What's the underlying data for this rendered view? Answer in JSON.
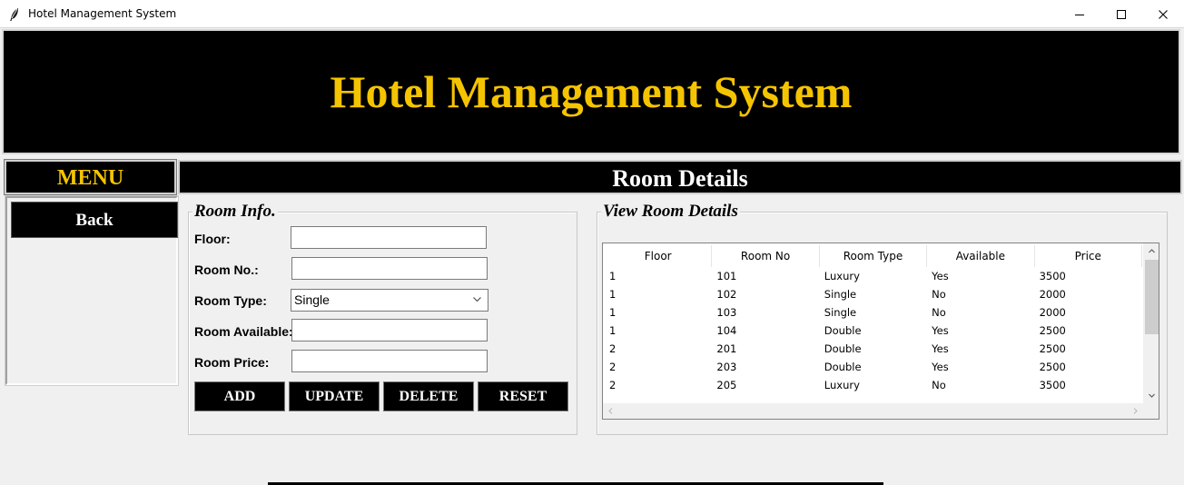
{
  "window": {
    "title": "Hotel Management System"
  },
  "banner": {
    "title": "Hotel Management System"
  },
  "menu": {
    "title": "MENU",
    "back_label": "Back"
  },
  "section": {
    "title": "Room Details"
  },
  "room_info": {
    "legend": "Room Info.",
    "floor_label": "Floor:",
    "floor_value": "",
    "room_no_label": "Room No.:",
    "room_no_value": "",
    "room_type_label": "Room Type:",
    "room_type_value": "Single",
    "room_available_label": "Room Available:",
    "room_available_value": "",
    "room_price_label": "Room Price:",
    "room_price_value": "",
    "buttons": {
      "add": "ADD",
      "update": "UPDATE",
      "delete": "DELETE",
      "reset": "RESET"
    }
  },
  "view_room": {
    "legend": "View Room Details",
    "columns": [
      "Floor",
      "Room No",
      "Room Type",
      "Available",
      "Price"
    ],
    "rows": [
      [
        "1",
        "101",
        "Luxury",
        "Yes",
        "3500"
      ],
      [
        "1",
        "102",
        "Single",
        "No",
        "2000"
      ],
      [
        "1",
        "103",
        "Single",
        "No",
        "2000"
      ],
      [
        "1",
        "104",
        "Double",
        "Yes",
        "2500"
      ],
      [
        "2",
        "201",
        "Double",
        "Yes",
        "2500"
      ],
      [
        "2",
        "203",
        "Double",
        "Yes",
        "2500"
      ],
      [
        "2",
        "205",
        "Luxury",
        "No",
        "3500"
      ]
    ]
  },
  "colors": {
    "banner_bg": "#000000",
    "title_gold": "#f5c400",
    "panel_bg": "#f0f0f0"
  },
  "icons": [
    "app-feather-icon",
    "minimize-icon",
    "maximize-icon",
    "close-icon",
    "chevron-down-icon",
    "scroll-up-icon",
    "scroll-down-icon",
    "scroll-left-icon",
    "scroll-right-icon"
  ]
}
